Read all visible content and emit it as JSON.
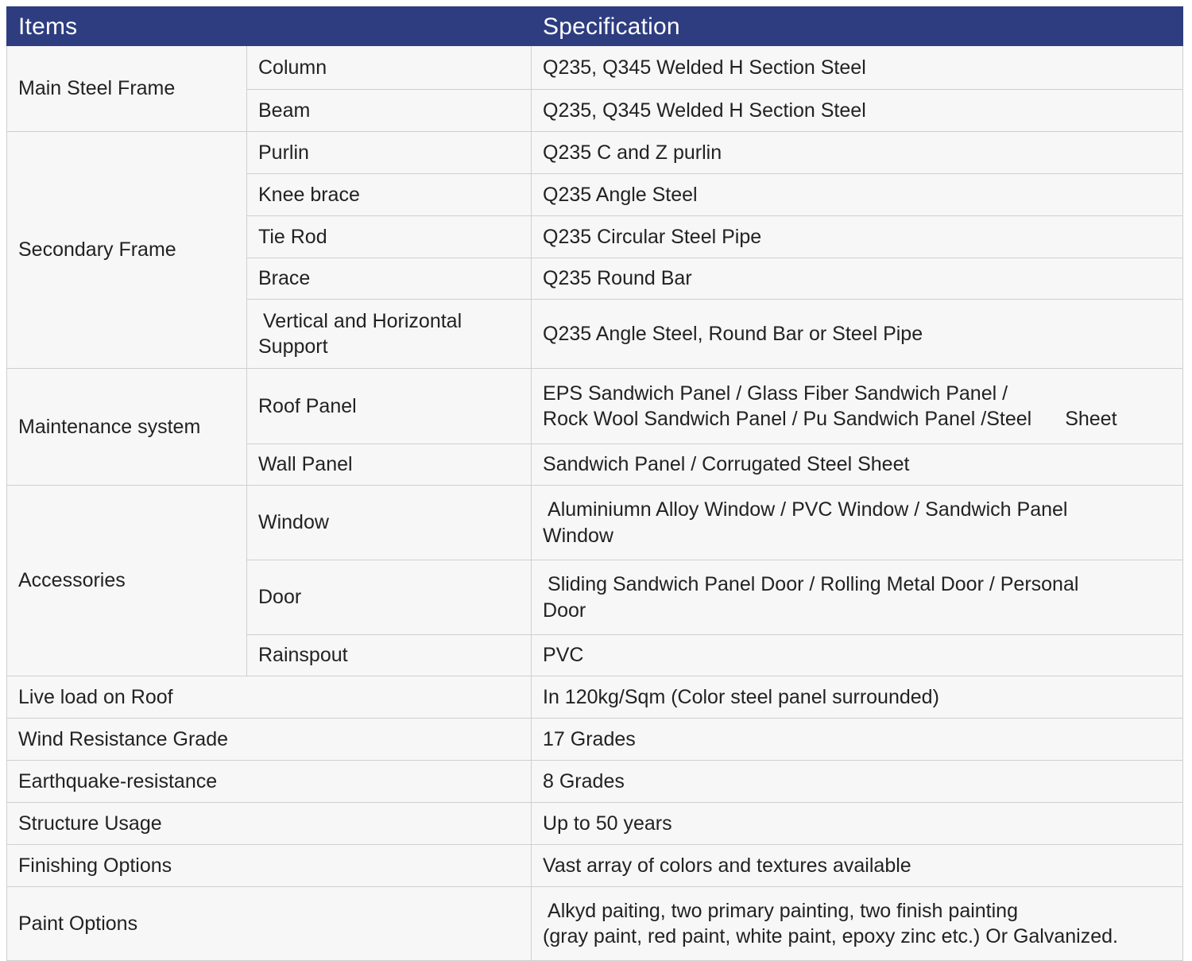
{
  "table": {
    "headers": {
      "items": "Items",
      "specification": "Specification"
    },
    "colors": {
      "header_bg": "#2e3d80",
      "header_text": "#ffffff",
      "cell_bg": "#f7f7f7",
      "border": "#cfcfcf",
      "text": "#222222"
    },
    "groups": [
      {
        "name": "Main Steel Frame",
        "rows": [
          {
            "item": "Column",
            "spec": "Q235, Q345 Welded H Section Steel"
          },
          {
            "item": "Beam",
            "spec": "Q235, Q345 Welded H Section Steel"
          }
        ]
      },
      {
        "name": "Secondary Frame",
        "rows": [
          {
            "item": "Purlin",
            "spec": "Q235 C and Z purlin"
          },
          {
            "item": "Knee brace",
            "spec": "Q235 Angle Steel"
          },
          {
            "item": "Tie Rod",
            "spec": "Q235 Circular Steel Pipe"
          },
          {
            "item": "Brace",
            "spec": "Q235 Round Bar"
          },
          {
            "item_line1": "Vertical and Horizontal",
            "item_line2": "Support",
            "spec": "Q235 Angle Steel, Round Bar or Steel Pipe"
          }
        ]
      },
      {
        "name": "Maintenance system",
        "rows": [
          {
            "item": "Roof Panel",
            "spec_line1": "EPS Sandwich Panel /  Glass Fiber Sandwich Panel /",
            "spec_line2a": "Rock Wool Sandwich Panel / Pu Sandwich Panel /Steel",
            "spec_line2b": "Sheet"
          },
          {
            "item": "Wall Panel",
            "spec": "Sandwich Panel / Corrugated Steel Sheet"
          }
        ]
      },
      {
        "name": "Accessories",
        "rows": [
          {
            "item": "Window",
            "spec_line1": "Aluminiumn Alloy Window / PVC Window / Sandwich Panel",
            "spec_line2": "Window"
          },
          {
            "item": "Door",
            "spec_line1": "Sliding Sandwich Panel Door / Rolling Metal Door / Personal",
            "spec_line2": "Door"
          },
          {
            "item": "Rainspout",
            "spec": "PVC"
          }
        ]
      }
    ],
    "flat_rows": [
      {
        "item": "Live load on Roof",
        "spec": "In 120kg/Sqm (Color steel panel surrounded)"
      },
      {
        "item": "Wind Resistance Grade",
        "spec": "17 Grades"
      },
      {
        "item": "Earthquake-resistance",
        "spec": "8 Grades"
      },
      {
        "item": "Structure Usage",
        "spec": "Up to 50 years"
      },
      {
        "item": "Finishing Options",
        "spec": "Vast array of colors and textures available"
      }
    ],
    "paint_row": {
      "item": "Paint Options",
      "spec_line1": "Alkyd paiting, two primary painting, two finish painting",
      "spec_line2": "(gray paint, red paint, white paint, epoxy zinc etc.) Or Galvanized."
    }
  }
}
